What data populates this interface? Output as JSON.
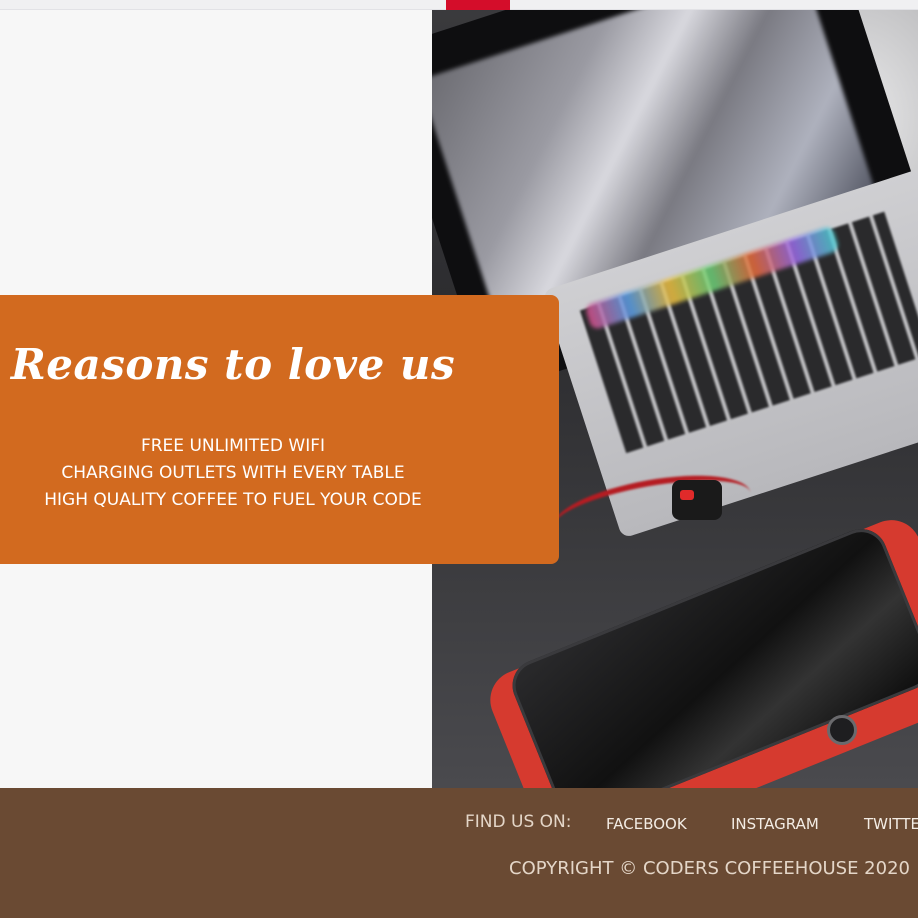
{
  "reasons": {
    "title": "Reasons to love us",
    "items": [
      "FREE UNLIMITED WIFI",
      "CHARGING OUTLETS WITH EVERY TABLE",
      "HIGH QUALITY COFFEE TO FUEL YOUR CODE"
    ]
  },
  "footer": {
    "find_us_label": "FIND US ON:",
    "links": [
      "FACEBOOK",
      "INSTAGRAM",
      "TWITTER"
    ],
    "copyright": "COPYRIGHT © CODERS COFFEEHOUSE 2020"
  },
  "colors": {
    "accent_orange": "#d26a1f",
    "footer_brown": "#6a4a33",
    "page_bg": "#f6f6f6"
  },
  "icons": {
    "photo": "laptop-and-phone-photo"
  }
}
